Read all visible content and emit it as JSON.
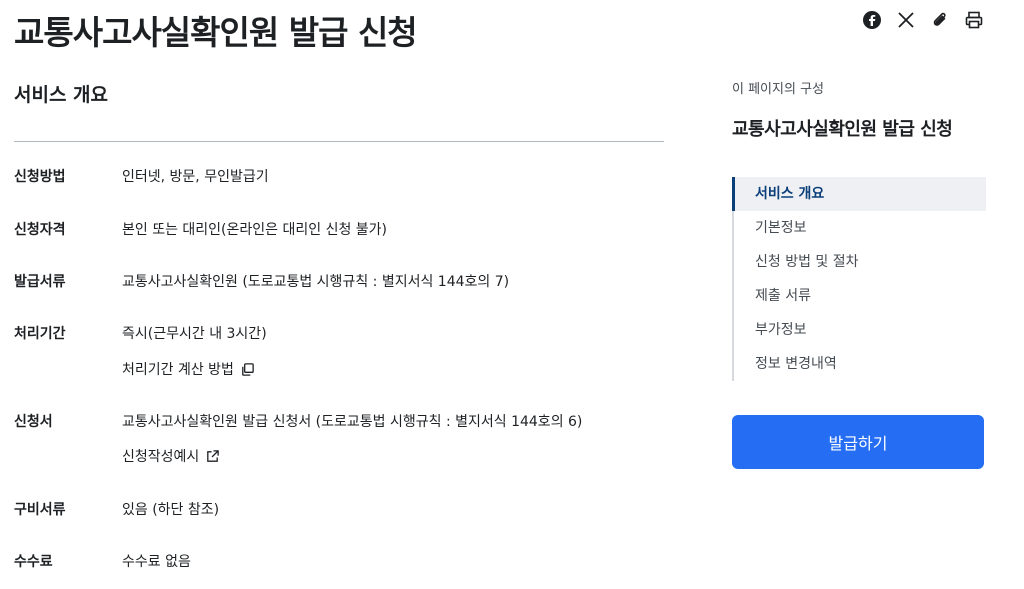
{
  "page_title": "교통사고사실확인원 발급 신청",
  "section_title": "서비스 개요",
  "rows": [
    {
      "label": "신청방법",
      "value": "인터넷, 방문, 무인발급기"
    },
    {
      "label": "신청자격",
      "value": "본인 또는 대리인(온라인은 대리인 신청 불가)"
    },
    {
      "label": "발급서류",
      "value": "교통사고사실확인원 (도로교통법 시행규칙 : 별지서식 144호의 7)"
    },
    {
      "label": "처리기간",
      "value": "즉시(근무시간 내 3시간)",
      "sub": "처리기간 계산 방법"
    },
    {
      "label": "신청서",
      "value": "교통사고사실확인원 발급 신청서 (도로교통법 시행규칙 : 별지서식 144호의 6)",
      "sub": "신청작성예시"
    },
    {
      "label": "구비서류",
      "value": "있음 (하단 참조)"
    },
    {
      "label": "수수료",
      "value": "수수료 없음"
    }
  ],
  "toc": {
    "caption": "이 페이지의 구성",
    "title": "교통사고사실확인원 발급 신청",
    "items": [
      "서비스 개요",
      "기본정보",
      "신청 방법 및 절차",
      "제출 서류",
      "부가정보",
      "정보 변경내역"
    ]
  },
  "issue_button": "발급하기",
  "icons": [
    "facebook-icon",
    "x-icon",
    "paperclip-icon",
    "print-icon",
    "copy-icon",
    "external-link-icon"
  ],
  "colors": {
    "accent": "#256ef4",
    "active_nav": "#0b3f7a",
    "active_bg": "#eef0f3"
  }
}
